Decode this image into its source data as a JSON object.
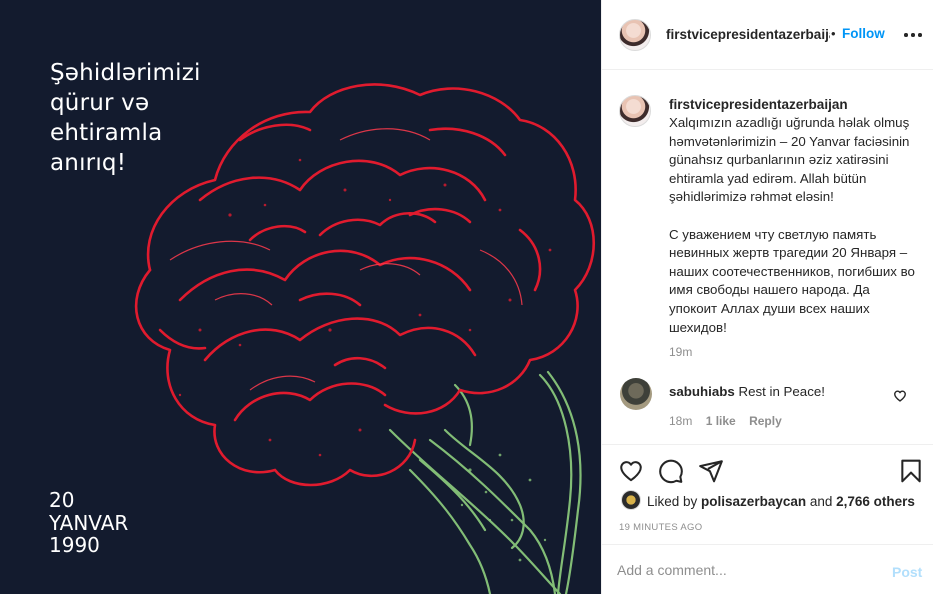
{
  "media": {
    "headline": "Şəhidlərimizi\nqürur və\nehtiramla\nanırıq!",
    "date_text": "20\nYANVAR\n1990",
    "background": "#131b2e",
    "flower_colors": {
      "petals": "#e01b2e",
      "stem": "#8fcf7e"
    }
  },
  "header": {
    "username": "firstvicepresidentazerbaijan",
    "separator": "•",
    "follow_label": "Follow",
    "more_icon": "more-dots-icon"
  },
  "caption": {
    "username": "firstvicepresidentazerbaijan",
    "text": "Xalqımızın azadlığı uğrunda həlak olmuş həmvətənlərimizin – 20 Yanvar faciəsinin günahsız qurbanlarının əziz xatirəsini ehtiramla yad edirəm. Allah bütün şəhidlərimizə rəhmət eləsin!\n\nС уважением чту светлую память невинных жертв трагедии 20 Января – наших соотечественников, погибших во имя свободы нашего народа. Да упокоит Аллах души всех наших шехидов!",
    "time": "19m"
  },
  "comment": {
    "username": "sabuhiabs",
    "text": "Rest in Peace!",
    "time": "18m",
    "likes": "1 like",
    "reply_label": "Reply"
  },
  "actions": {
    "liked_by_prefix": "Liked by ",
    "liked_by_user": "polisazerbaycan",
    "liked_by_middle": " and ",
    "liked_by_count": "2,766 others",
    "post_age": "19 MINUTES AGO"
  },
  "add_comment": {
    "placeholder": "Add a comment...",
    "post_label": "Post"
  },
  "colors": {
    "accent": "#0095f6",
    "post_disabled": "#b2dffc",
    "muted": "#8e8e8e",
    "text": "#262626"
  }
}
